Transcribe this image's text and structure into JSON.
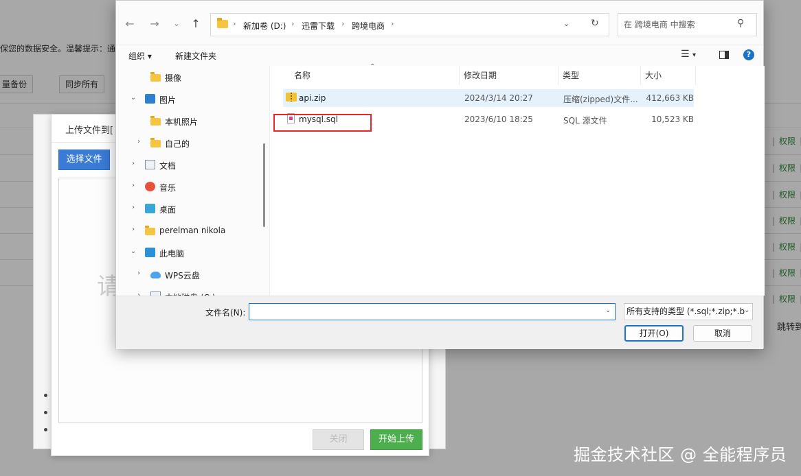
{
  "background_page": {
    "tip_text": "保您的数据安全。温馨提示：通",
    "batch_backup_label": "量备份",
    "sync_all_label": "同步所有",
    "permission_label": "权限",
    "separator": "|",
    "separator_tail": "i",
    "pager_text": "跳转到"
  },
  "upload_dialog": {
    "title": "上传文件到[",
    "choose_file_label": "选择文件",
    "drop_hint": "请",
    "close_label": "关闭",
    "start_upload_label": "开始上传"
  },
  "file_dialog": {
    "breadcrumb": [
      "新加卷 (D:)",
      "迅雷下载",
      "跨境电商"
    ],
    "search_placeholder": "在 跨境电商 中搜索",
    "toolbar": {
      "organize_label": "组织",
      "new_folder_label": "新建文件夹",
      "help_label": "?"
    },
    "nav_items": [
      {
        "label": "摄像",
        "icon": "folder-icon"
      },
      {
        "label": "图片",
        "icon": "pictures-icon"
      },
      {
        "label": "本机照片",
        "icon": "folder-icon"
      },
      {
        "label": "自己的",
        "icon": "folder-icon"
      },
      {
        "label": "文档",
        "icon": "documents-icon"
      },
      {
        "label": "音乐",
        "icon": "music-icon"
      },
      {
        "label": "桌面",
        "icon": "desktop-icon"
      },
      {
        "label": "perelman nikola",
        "icon": "folder-icon"
      },
      {
        "label": "此电脑",
        "icon": "computer-icon"
      },
      {
        "label": "WPS云盘",
        "icon": "cloud-icon"
      },
      {
        "label": "本地磁盘 (C:)",
        "icon": "drive-icon"
      }
    ],
    "columns": [
      "名称",
      "修改日期",
      "类型",
      "大小"
    ],
    "files": [
      {
        "name": "api.zip",
        "date": "2024/3/14 20:27",
        "type": "压缩(zipped)文件...",
        "size": "412,663 KB",
        "icon": "zip-file-icon"
      },
      {
        "name": "mysql.sql",
        "date": "2023/6/10 18:25",
        "type": "SQL 源文件",
        "size": "10,523 KB",
        "icon": "sql-file-icon"
      }
    ],
    "filename_label": "文件名(N):",
    "filename_value": "",
    "filetype_value": "所有支持的类型 (*.sql;*.zip;*.b",
    "open_label": "打开(O)",
    "cancel_label": "取消"
  },
  "watermark": "掘金技术社区 @ 全能程序员",
  "colors": {
    "accent_blue": "#1a73c8",
    "upload_green": "#4cae4c",
    "choose_blue": "#3a7bd5",
    "highlight_red": "#e8262b",
    "permission_green": "#2e8b3a"
  }
}
